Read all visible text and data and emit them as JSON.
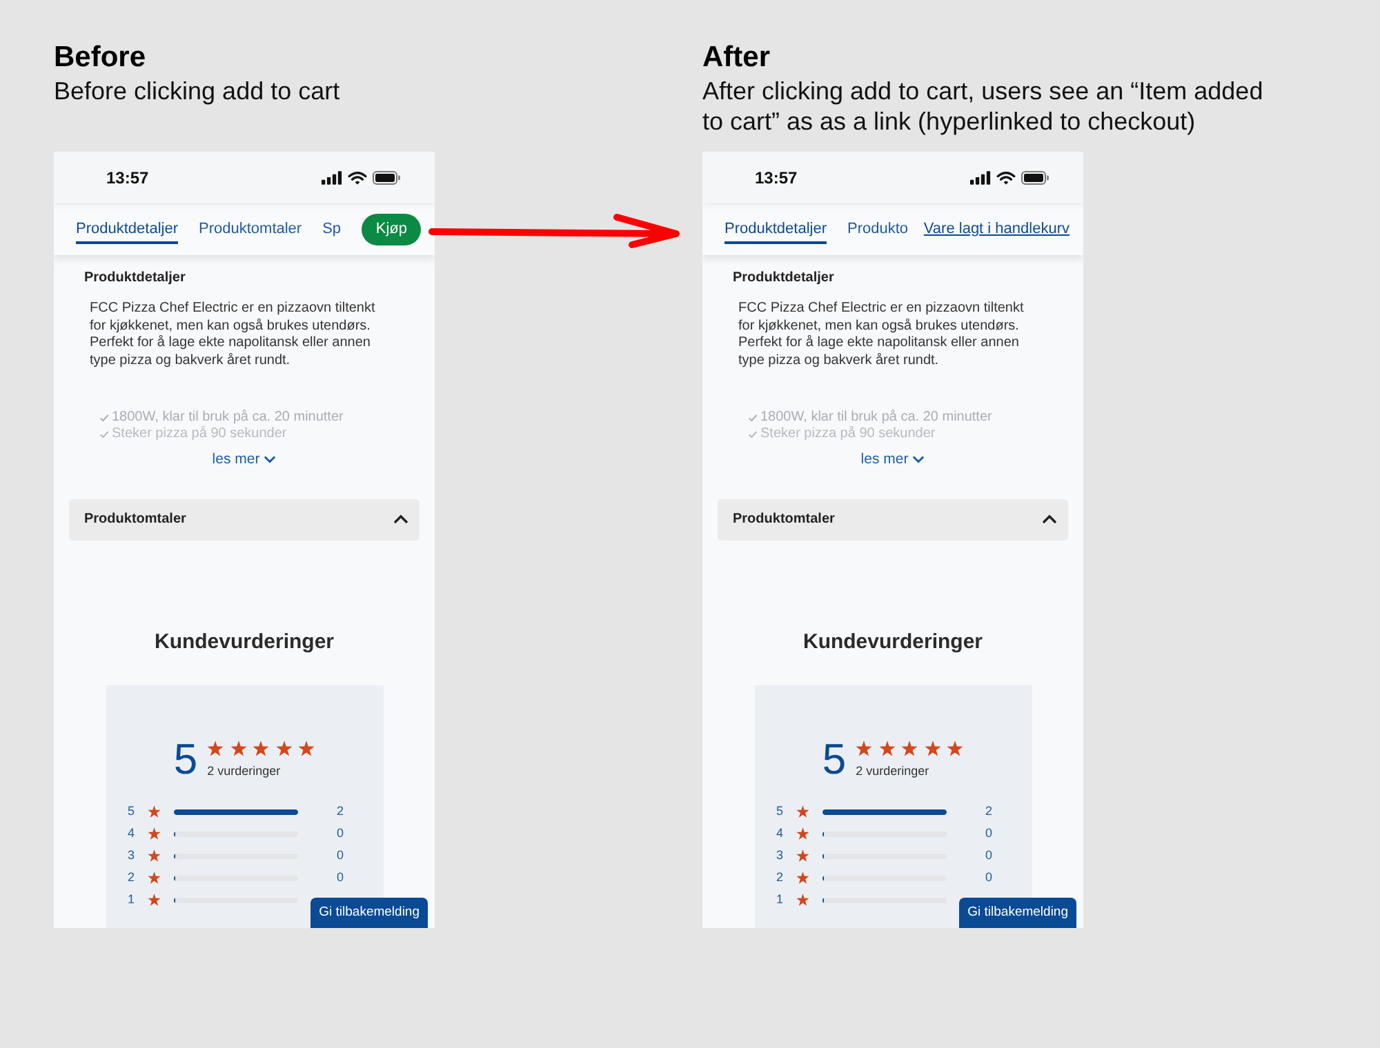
{
  "panels": [
    {
      "heading": "Before",
      "caption": "Before clicking add to cart",
      "phone": {
        "status_bar": {
          "time": "13:57"
        },
        "tabs": [
          {
            "label": "Produktdetaljer",
            "selected": true
          },
          {
            "label": "Produktomtaler",
            "selected": false
          },
          {
            "label": "Sp",
            "selected": false
          }
        ],
        "action": {
          "kind": "buy_button",
          "label": "Kjøp"
        },
        "details": {
          "heading": "Produktdetaljer",
          "text": "FCC Pizza Chef Electric er en pizzaovn tiltenkt for kjøkkenet, men kan også brukes utendørs. Perfekt for å lage ekte napolitansk eller annen type pizza og bakverk året rundt.",
          "features": [
            "1800W, klar til bruk på ca. 20 minutter",
            "Steker pizza på 90 sekunder"
          ],
          "more_link": "les mer"
        },
        "accordion": {
          "title": "Produktomtaler",
          "expanded": true
        },
        "ratings": {
          "heading": "Kundevurderinger",
          "score": "5",
          "stars": 5,
          "count_label": "2 vurderinger",
          "rows": [
            {
              "label": "5",
              "level": 1,
              "count": "2"
            },
            {
              "label": "4",
              "level": 0,
              "count": "0"
            },
            {
              "label": "3",
              "level": 0,
              "count": "0"
            },
            {
              "label": "2",
              "level": 0,
              "count": "0"
            },
            {
              "label": "1",
              "level": 0
            }
          ]
        },
        "feedback_button": "Gi tilbakemelding"
      }
    },
    {
      "heading": "After",
      "caption": "After clicking add to cart, users see an “Item added to cart” as as a link (hyperlinked to checkout)",
      "phone": {
        "status_bar": {
          "time": "13:57"
        },
        "tabs": [
          {
            "label": "Produktdetaljer",
            "selected": true
          },
          {
            "label": "Produkto",
            "selected": false
          }
        ],
        "action": {
          "kind": "cart_link",
          "label": "Vare lagt i handlekurv"
        },
        "details": {
          "heading": "Produktdetaljer",
          "text": "FCC Pizza Chef Electric er en pizzaovn tiltenkt for kjøkkenet, men kan også brukes utendørs. Perfekt for å lage ekte napolitansk eller annen type pizza og bakverk året rundt.",
          "features": [
            "1800W, klar til bruk på ca. 20 minutter",
            "Steker pizza på 90 sekunder"
          ],
          "more_link": "les mer"
        },
        "accordion": {
          "title": "Produktomtaler",
          "expanded": true
        },
        "ratings": {
          "heading": "Kundevurderinger",
          "score": "5",
          "stars": 5,
          "count_label": "2 vurderinger",
          "rows": [
            {
              "label": "5",
              "level": 1,
              "count": "2"
            },
            {
              "label": "4",
              "level": 0,
              "count": "0"
            },
            {
              "label": "3",
              "level": 0,
              "count": "0"
            },
            {
              "label": "2",
              "level": 0,
              "count": "0"
            },
            {
              "label": "1",
              "level": 0
            }
          ]
        },
        "feedback_button": "Gi tilbakemelding"
      }
    }
  ]
}
